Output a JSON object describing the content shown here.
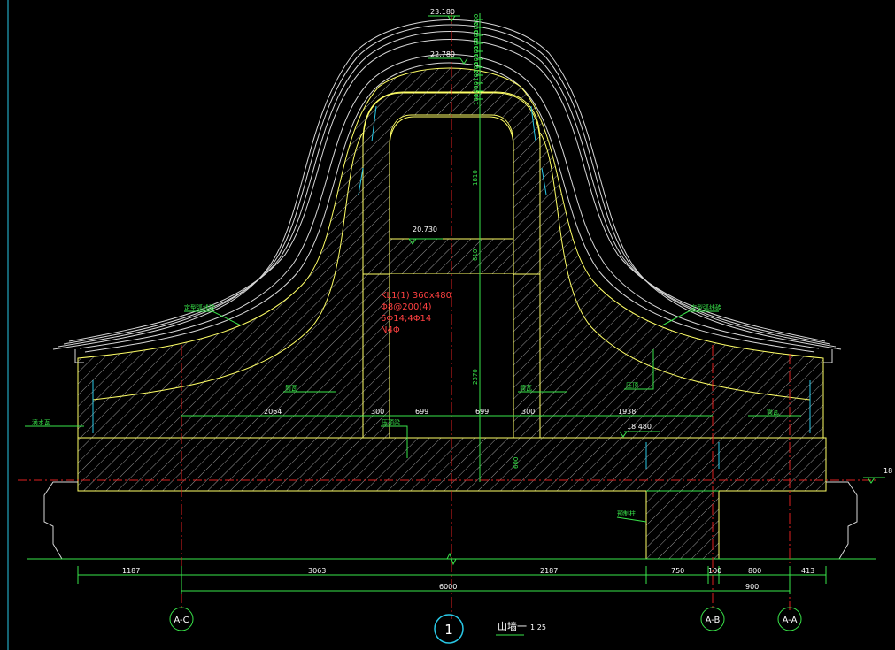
{
  "elevations": {
    "top": "23.180",
    "ridge": "22.780",
    "beam": "20.730",
    "base": "18.480",
    "right_edge": "18"
  },
  "beam_note": {
    "line1": "KL1(1) 360x480",
    "line2": "Φ8@200(4)",
    "line3": "6Φ14;4Φ14",
    "line4": "N4Φ"
  },
  "top_dims": [
    "200",
    "100",
    "400",
    "100",
    "100",
    "100",
    "200",
    "100",
    "60",
    "100",
    "100"
  ],
  "vertical_dims": [
    "1810",
    "610",
    "2370",
    "600"
  ],
  "inner_dims": [
    "2064",
    "300",
    "699",
    "699",
    "300",
    "1938"
  ],
  "bottom_dims": [
    "1187",
    "3063",
    "2187",
    "750",
    "100",
    "800",
    "413"
  ],
  "total_dims": {
    "left_total": "6000",
    "right_total": "900"
  },
  "axes": {
    "left": "A-C",
    "right1": "A-B",
    "right2": "A-A"
  },
  "section": {
    "number": "1",
    "title": "山墙一",
    "scale": "1:25"
  },
  "annotations": {
    "left_curve": "定型弧线砖",
    "right_curve": "定型弧线砖",
    "left_edge": "滴水瓦",
    "left_inner": "筒瓦",
    "center_pier": "筒瓦",
    "right_inner": "压顶",
    "right_edge": "筒瓦",
    "center_base": "压顶梁",
    "support": "预制柱"
  },
  "colors": {
    "background": "#000000",
    "outline": "#ffff66",
    "hatch": "#cfcfcf",
    "dim_green": "#39e64a",
    "axis_red": "#e02020",
    "cyan": "#29c8e6"
  }
}
